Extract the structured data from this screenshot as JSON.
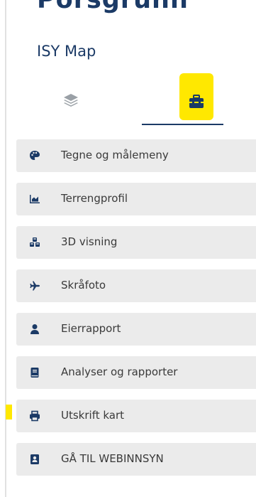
{
  "header": {
    "title": "Porsgrunn",
    "subtitle": "ISY Map"
  },
  "tabs": [
    {
      "name": "layers",
      "icon": "layers-icon",
      "active": false
    },
    {
      "name": "tools",
      "icon": "toolbox-icon",
      "active": true
    }
  ],
  "menu": {
    "items": [
      {
        "label": "Tegne og målemeny",
        "icon": "palette-icon"
      },
      {
        "label": "Terrengprofil",
        "icon": "area-chart-icon"
      },
      {
        "label": "3D visning",
        "icon": "cubes-icon"
      },
      {
        "label": "Skråfoto",
        "icon": "plane-icon"
      },
      {
        "label": "Eierrapport",
        "icon": "user-icon"
      },
      {
        "label": "Analyser og rapporter",
        "icon": "book-icon"
      },
      {
        "label": "Utskrift kart",
        "icon": "print-icon"
      },
      {
        "label": "GÅ TIL WEBINNSYN",
        "icon": "id-card-icon"
      }
    ]
  },
  "colors": {
    "brand": "#1b3a66",
    "highlight": "#ffe800",
    "menu_background": "#ebebeb"
  }
}
